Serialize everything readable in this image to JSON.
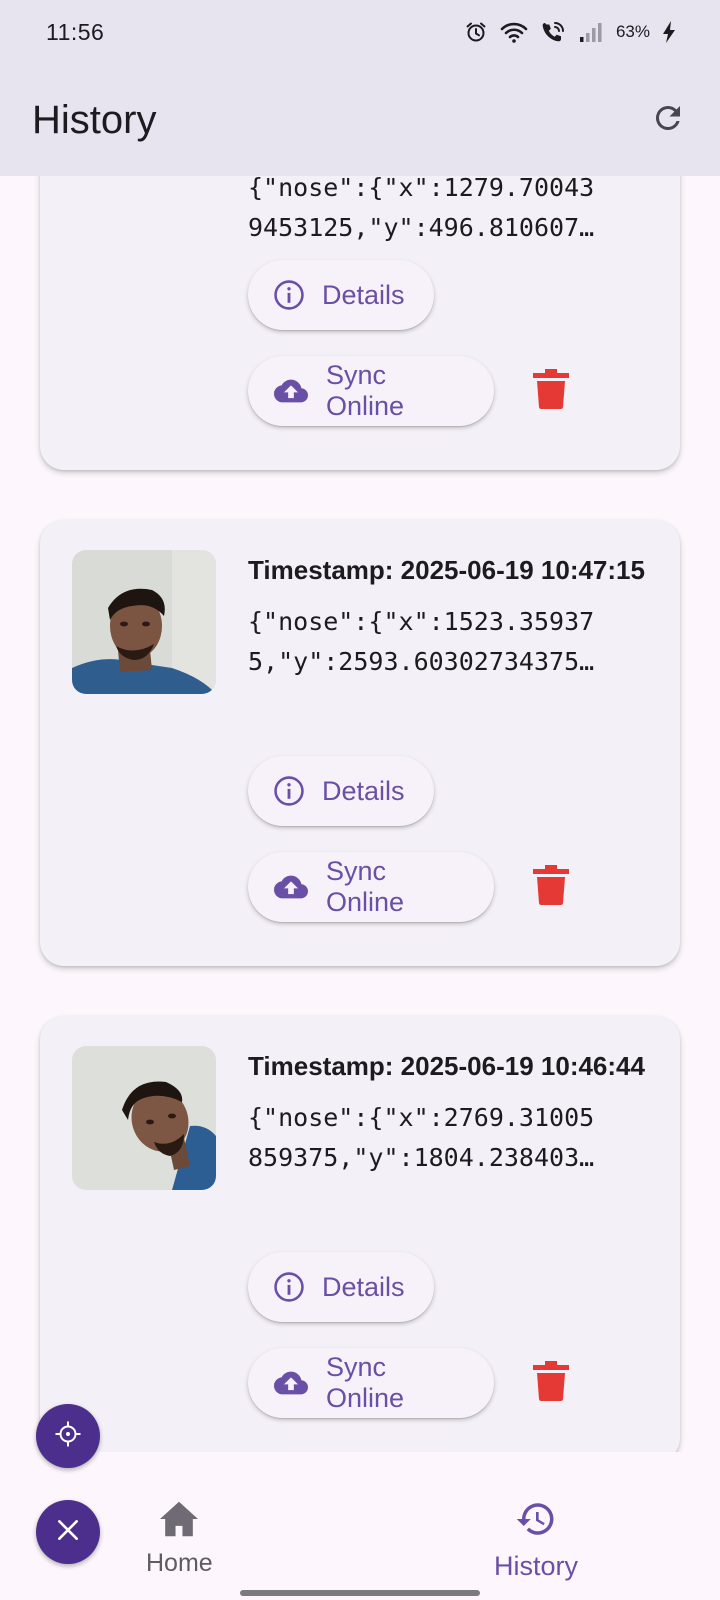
{
  "status_bar": {
    "time": "11:56",
    "battery": "63%"
  },
  "app_bar": {
    "title": "History"
  },
  "records": [
    {
      "timestamp": "",
      "pose_line1": "{\"nose\":{\"x\":1279.70043",
      "pose_line2": "9453125,\"y\":496.810607…",
      "details_label": "Details",
      "sync_label": "Sync Online"
    },
    {
      "timestamp": "Timestamp: 2025-06-19 10:47:15",
      "pose_line1": "{\"nose\":{\"x\":1523.35937",
      "pose_line2": "5,\"y\":2593.60302734375…",
      "details_label": "Details",
      "sync_label": "Sync Online"
    },
    {
      "timestamp": "Timestamp: 2025-06-19 10:46:44",
      "pose_line1": "{\"nose\":{\"x\":2769.31005",
      "pose_line2": "859375,\"y\":1804.238403…",
      "details_label": "Details",
      "sync_label": "Sync Online"
    }
  ],
  "bottom_nav": {
    "home_label": "Home",
    "history_label": "History",
    "active": "History"
  },
  "colors": {
    "accent": "#6a4fa6",
    "fab": "#4c2f8d",
    "delete": "#e53935",
    "app_bar_bg": "#e7e3ef",
    "card_bg": "#f4f0f7"
  },
  "icons": {
    "refresh": "refresh-icon",
    "details": "info-icon",
    "sync": "cloud-upload-icon",
    "delete": "trash-icon",
    "fab_top": "crosshair-icon",
    "fab_bottom": "close-icon",
    "home": "home-icon",
    "history": "history-icon"
  }
}
